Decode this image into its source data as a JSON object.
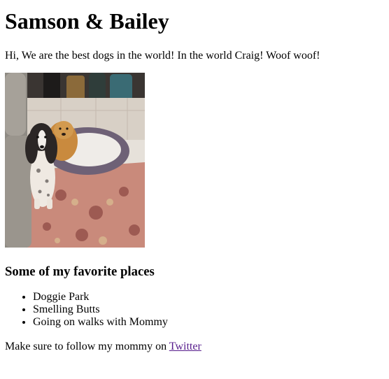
{
  "page": {
    "title": "Samson & Bailey",
    "intro": "Hi, We are the best dogs in the world! In the world Craig! Woof woof!",
    "photo": {
      "icon": "dogs-photo"
    },
    "favorites": {
      "heading": "Some of my favorite places",
      "items": [
        "Doggie Park",
        "Smelling Butts",
        "Going on walks with Mommy"
      ]
    },
    "follow": {
      "text": "Make sure to follow my mommy on ",
      "link_label": "Twitter",
      "link_color": "#551a8b"
    }
  }
}
